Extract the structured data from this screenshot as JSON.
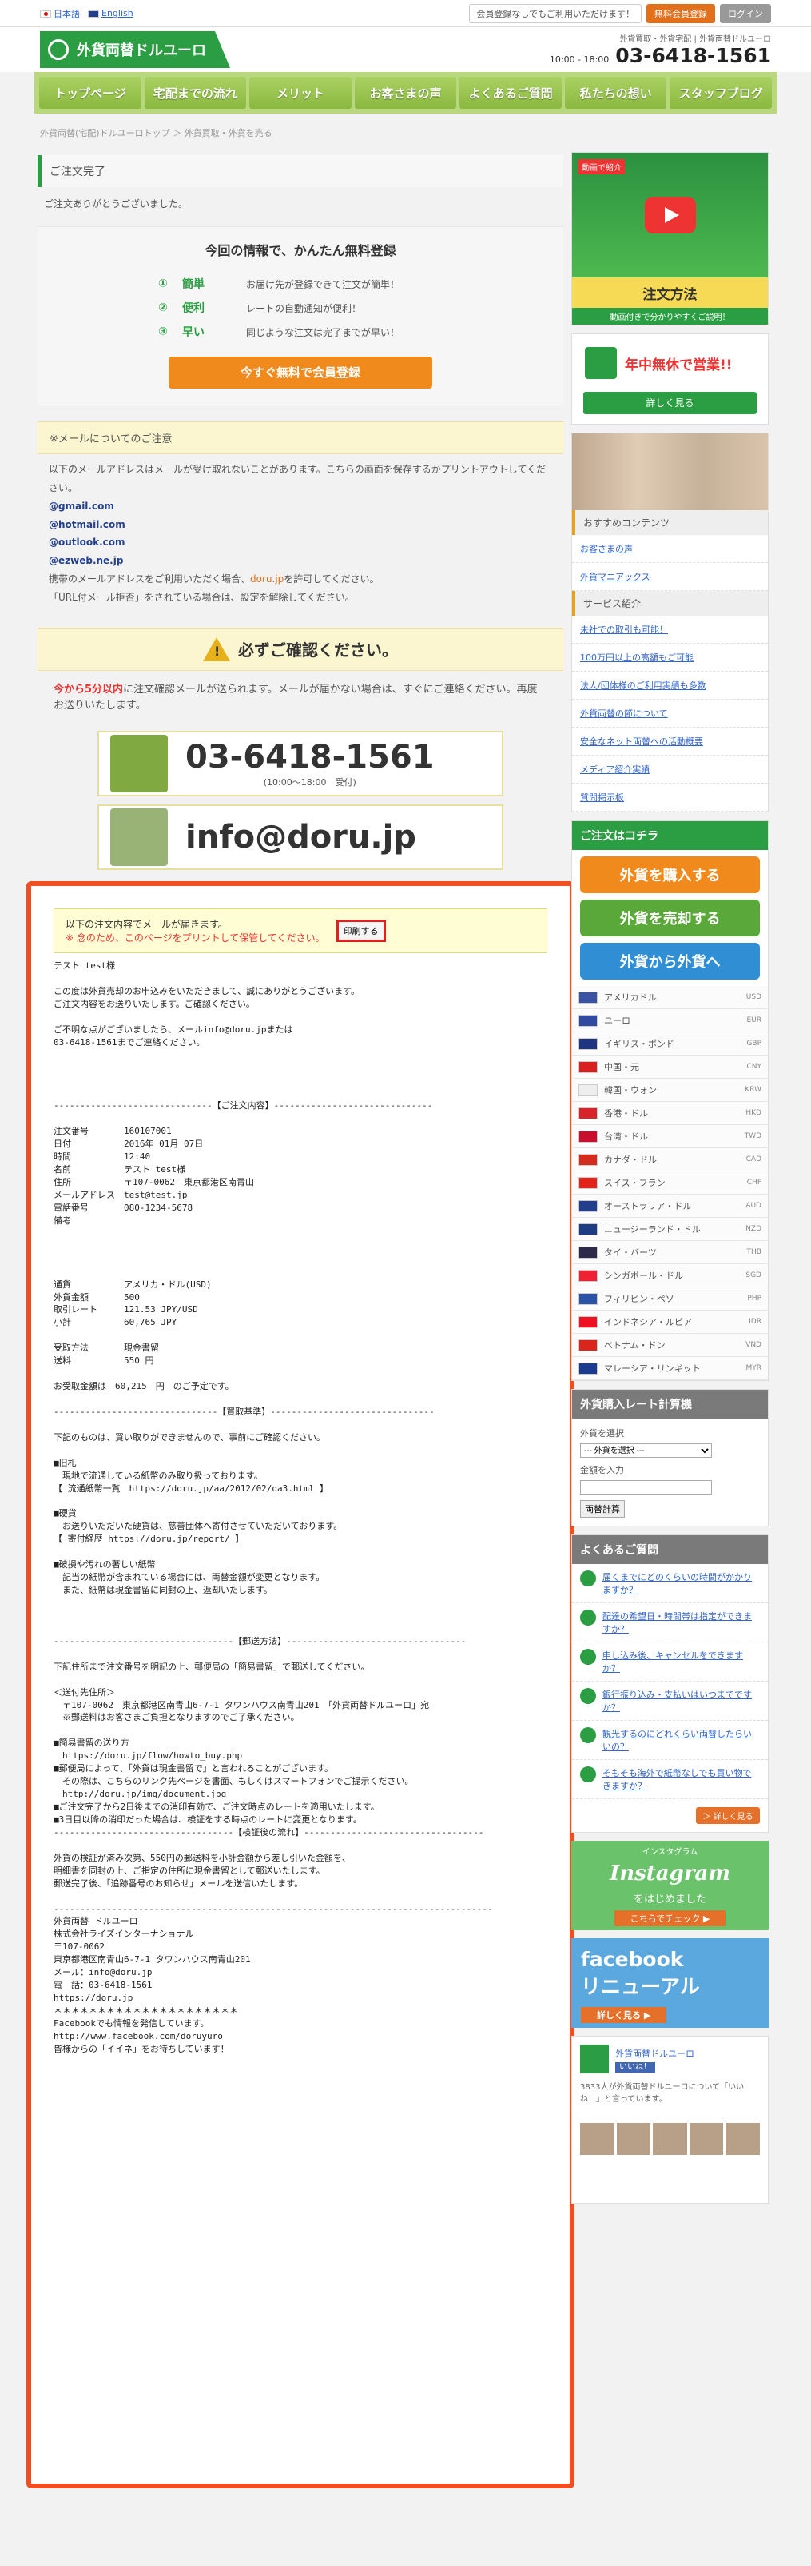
{
  "topbar": {
    "lang_ja": "日本語",
    "lang_en": "English",
    "notice": "会員登録なしでもご利用いただけます！",
    "register": "無料会員登録",
    "login": "ログイン"
  },
  "header": {
    "logo": "外貨両替ドルユーロ",
    "tagline": "外貨買取・外貨宅配 | 外貨両替ドルユーロ",
    "hours": "10:00 - 18:00",
    "tel": "03-6418-1561"
  },
  "nav": [
    "トップページ",
    "宅配までの流れ",
    "メリット",
    "お客さまの声",
    "よくあるご質問",
    "私たちの想い",
    "スタッフブログ"
  ],
  "breadcrumb": "外貨両替(宅配)ドルユーロトップ ＞ 外貨買取・外貨を売る",
  "main": {
    "title": "ご注文完了",
    "thanks": "ご注文ありがとうございました。",
    "reg_title": "今回の情報で、かんたん無料登録",
    "features": [
      {
        "n": "①",
        "t": "簡単",
        "d": "お届け先が登録できて注文が簡単！"
      },
      {
        "n": "②",
        "t": "便利",
        "d": "レートの自動通知が便利！"
      },
      {
        "n": "③",
        "t": "早い",
        "d": "同じような注文は完了までが早い！"
      }
    ],
    "reg_btn": "今すぐ無料で会員登録",
    "mail_note_title": "※メールについてのご注意",
    "mail_note": "以下のメールアドレスはメールが受け取れないことがあります。こちらの画面を保存するかプリントアウトしてください。",
    "domains": [
      "@gmail.com",
      "@hotmail.com",
      "@outlook.com",
      "@ezweb.ne.jp"
    ],
    "mobile_note_a": "携帯のメールアドレスをご利用いただく場合、",
    "mobile_note_link": "doru.jp",
    "mobile_note_b": "を許可してください。",
    "mobile_note2": "「URL付メール拒否」をされている場合は、設定を解除してください。",
    "confirm_title": "必ずご確認ください。",
    "warn_red": "今から5分以内",
    "warn_rest": "に注文確認メールが送られます。メールが届かない場合は、すぐにご連絡ください。再度お送りいたします。",
    "tel": "03-6418-1561",
    "tel_hours": "(10:00〜18:00　受付)",
    "email": "info@doru.jp"
  },
  "mailbox": {
    "head1": "以下の注文内容でメールが届きます。",
    "head2": "※ 念のため、このページをプリントして保管してください。",
    "print": "印刷する",
    "body": "テスト test様\n\nこの度は外貨売却のお申込みをいただきまして、誠にありがとうございます。\nご注文内容をお送りいたします。ご確認ください。\n\nご不明な点がございましたら、メールinfo@doru.jpまたは\n03-6418-1561までご連絡ください。\n\n\n\n\n------------------------------【ご注文内容】------------------------------\n\n注文番号　　　　160107001\n日付　　　　　　2016年 01月 07日\n時間　　　　　　12:40\n名前　　　　　　テスト test様\n住所　　　　　　〒107-0062　東京都港区南青山\nメールアドレス　test@test.jp\n電話番号　　　　080-1234-5678\n備考\n\n\n\n\n通貨　　　　　　アメリカ・ドル(USD)\n外貨金額　　　　500\n取引レート　　　121.53 JPY/USD\n小計　　　　　　60,765 JPY\n\n受取方法　　　　現金書留\n送料　　　　　　550 円\n\nお受取金額は　60,215　円　のご予定です。\n\n-------------------------------【買取基準】-------------------------------\n\n下記のものは、買い取りができませんので、事前にご確認ください。\n\n■旧札\n　現地で流通している紙幣のみ取り扱っております。\n【 流通紙幣一覧　https://doru.jp/aa/2012/02/qa3.html 】\n\n■硬貨\n　お送りいただいた硬貨は、慈善団体へ寄付させていただいております。\n【 寄付経歴 https://doru.jp/report/ 】\n\n■破損や汚れの著しい紙幣\n　記当の紙幣が含まれている場合には、両替金額が変更となります。\n　また、紙幣は現金書留に同封の上、返却いたします。\n\n\n\n----------------------------------【郵送方法】----------------------------------\n\n下記住所まで注文番号を明記の上、郵便局の「簡易書留」で郵送してください。\n\n＜送付先住所＞\n　〒107-0062　東京都港区南青山6-7-1 タワンハウス南青山201　「外貨両替ドルユーロ」宛\n　※郵送料はお客さまご負担となりますのでご了承ください。\n\n■簡易書留の送り方\n　https://doru.jp/flow/howto_buy.php\n■郵便局によって、「外貨は現金書留で」と言われることがございます。\n　その際は、こちらのリンク先ページを書面、もしくはスマートフォンでご提示ください。\n　http://doru.jp/img/document.jpg\n■ご注文完了から2日後までの消印有効で、ご注文時点のレートを適用いたします。\n■3日目以降の消印だった場合は、検証をする時点のレートに変更となります。\n----------------------------------【検証後の流れ】----------------------------------\n\n外貨の検証が済み次第、550円の郵送料を小計金額から差し引いた金額を、\n明細書を同封の上、ご指定の住所に現金書留として郵送いたします。\n郵送完了後、「追跡番号のお知らせ」メールを送信いたします。\n\n-----------------------------------------------------------------------------------\n外貨両替 ドルユーロ\n株式会社ライズインターナショナル\n〒107-0062\n東京都港区南青山6-7-1 タワンハウス南青山201\nメール：info@doru.jp\n電　話：03-6418-1561\nhttps://doru.jp\n＊＊＊＊＊＊＊＊＊＊＊＊＊＊＊＊＊＊＊＊＊\nFacebookでも情報を発信しています。\nhttp://www.facebook.com/doruyuro\n皆様からの「イイネ」をお待ちしています！"
  },
  "side": {
    "video_label": "動画で紹介",
    "chuumon": "注文方法",
    "chuumon_sub": "動画付きで分かりやすくご説明！",
    "nenchu": "年中無休で営業!!",
    "detail": "詳しく見る",
    "recommend": "おすすめコンテンツ",
    "links1": [
      "お客さまの声",
      "外貨マニアックス"
    ],
    "service": "サービス紹介",
    "links2": [
      "未社での取引も可能！",
      "100万円以上の高額もご可能",
      "法人/団体様のご利用実績も多数",
      "外貨両替の節について",
      "安全なネット両替への活動概要",
      "メディア紹介実績",
      "質問掲示板"
    ],
    "order_title": "ご注文はコチラ",
    "btn_buy": "外貨を購入する",
    "btn_sell": "外貨を売却する",
    "btn_exchange": "外貨から外貨へ",
    "currencies": [
      {
        "n": "アメリカドル",
        "c": "USD",
        "col": "#3a53a4"
      },
      {
        "n": "ユーロ",
        "c": "EUR",
        "col": "#2f4aa0"
      },
      {
        "n": "イギリス・ポンド",
        "c": "GBP",
        "col": "#1f3580"
      },
      {
        "n": "中国・元",
        "c": "CNY",
        "col": "#d91f1f"
      },
      {
        "n": "韓国・ウォン",
        "c": "KRW",
        "col": "#eeeeee"
      },
      {
        "n": "香港・ドル",
        "c": "HKD",
        "col": "#d8232a"
      },
      {
        "n": "台湾・ドル",
        "c": "TWD",
        "col": "#c8102e"
      },
      {
        "n": "カナダ・ドル",
        "c": "CAD",
        "col": "#d52b1e"
      },
      {
        "n": "スイス・フラン",
        "c": "CHF",
        "col": "#e2231a"
      },
      {
        "n": "オーストラリア・ドル",
        "c": "AUD",
        "col": "#233e8b"
      },
      {
        "n": "ニュージーランド・ドル",
        "c": "NZD",
        "col": "#1d3c83"
      },
      {
        "n": "タイ・バーツ",
        "c": "THB",
        "col": "#2d2a4a"
      },
      {
        "n": "シンガポール・ドル",
        "c": "SGD",
        "col": "#e23"
      },
      {
        "n": "フィリピン・ペソ",
        "c": "PHP",
        "col": "#2a53a8"
      },
      {
        "n": "インドネシア・ルピア",
        "c": "IDR",
        "col": "#e12"
      },
      {
        "n": "ベトナム・ドン",
        "c": "VND",
        "col": "#da251d"
      },
      {
        "n": "マレーシア・リンギット",
        "c": "MYR",
        "col": "#1a3b8f"
      }
    ],
    "calc_title": "外貨購入レート計算機",
    "calc_select_label": "外貨を選択",
    "calc_select": "--- 外貨を選択 ---",
    "calc_amount_label": "金額を入力",
    "calc_btn": "両替計算",
    "faq_title": "よくあるご質問",
    "faqs": [
      "届くまでにどのくらいの時間がかかりますか？",
      "配達の希望日・時間帯は指定ができますか？",
      "申し込み後、キャンセルをできますか？",
      "銀行振り込み・支払いはいつまでですか？",
      "観光するのにどれくらい両替したらいいの？",
      "そもそも海外で紙幣なしでも買い物できますか？"
    ],
    "more": "＞ 詳しく見る",
    "insta_small": "インスタグラム",
    "insta": "Instagram",
    "insta_sub": "をはじめました",
    "insta_check": "こちらでチェック ▶",
    "fb": "facebook\nリニューアル",
    "fb_check": "詳しく見る ▶",
    "fb_page": "外貨両替ドルユーロ",
    "fb_like": "いいね！",
    "fb_note": "3833人が外貨両替ドルユーロについて「いいね！」と言っています。"
  }
}
